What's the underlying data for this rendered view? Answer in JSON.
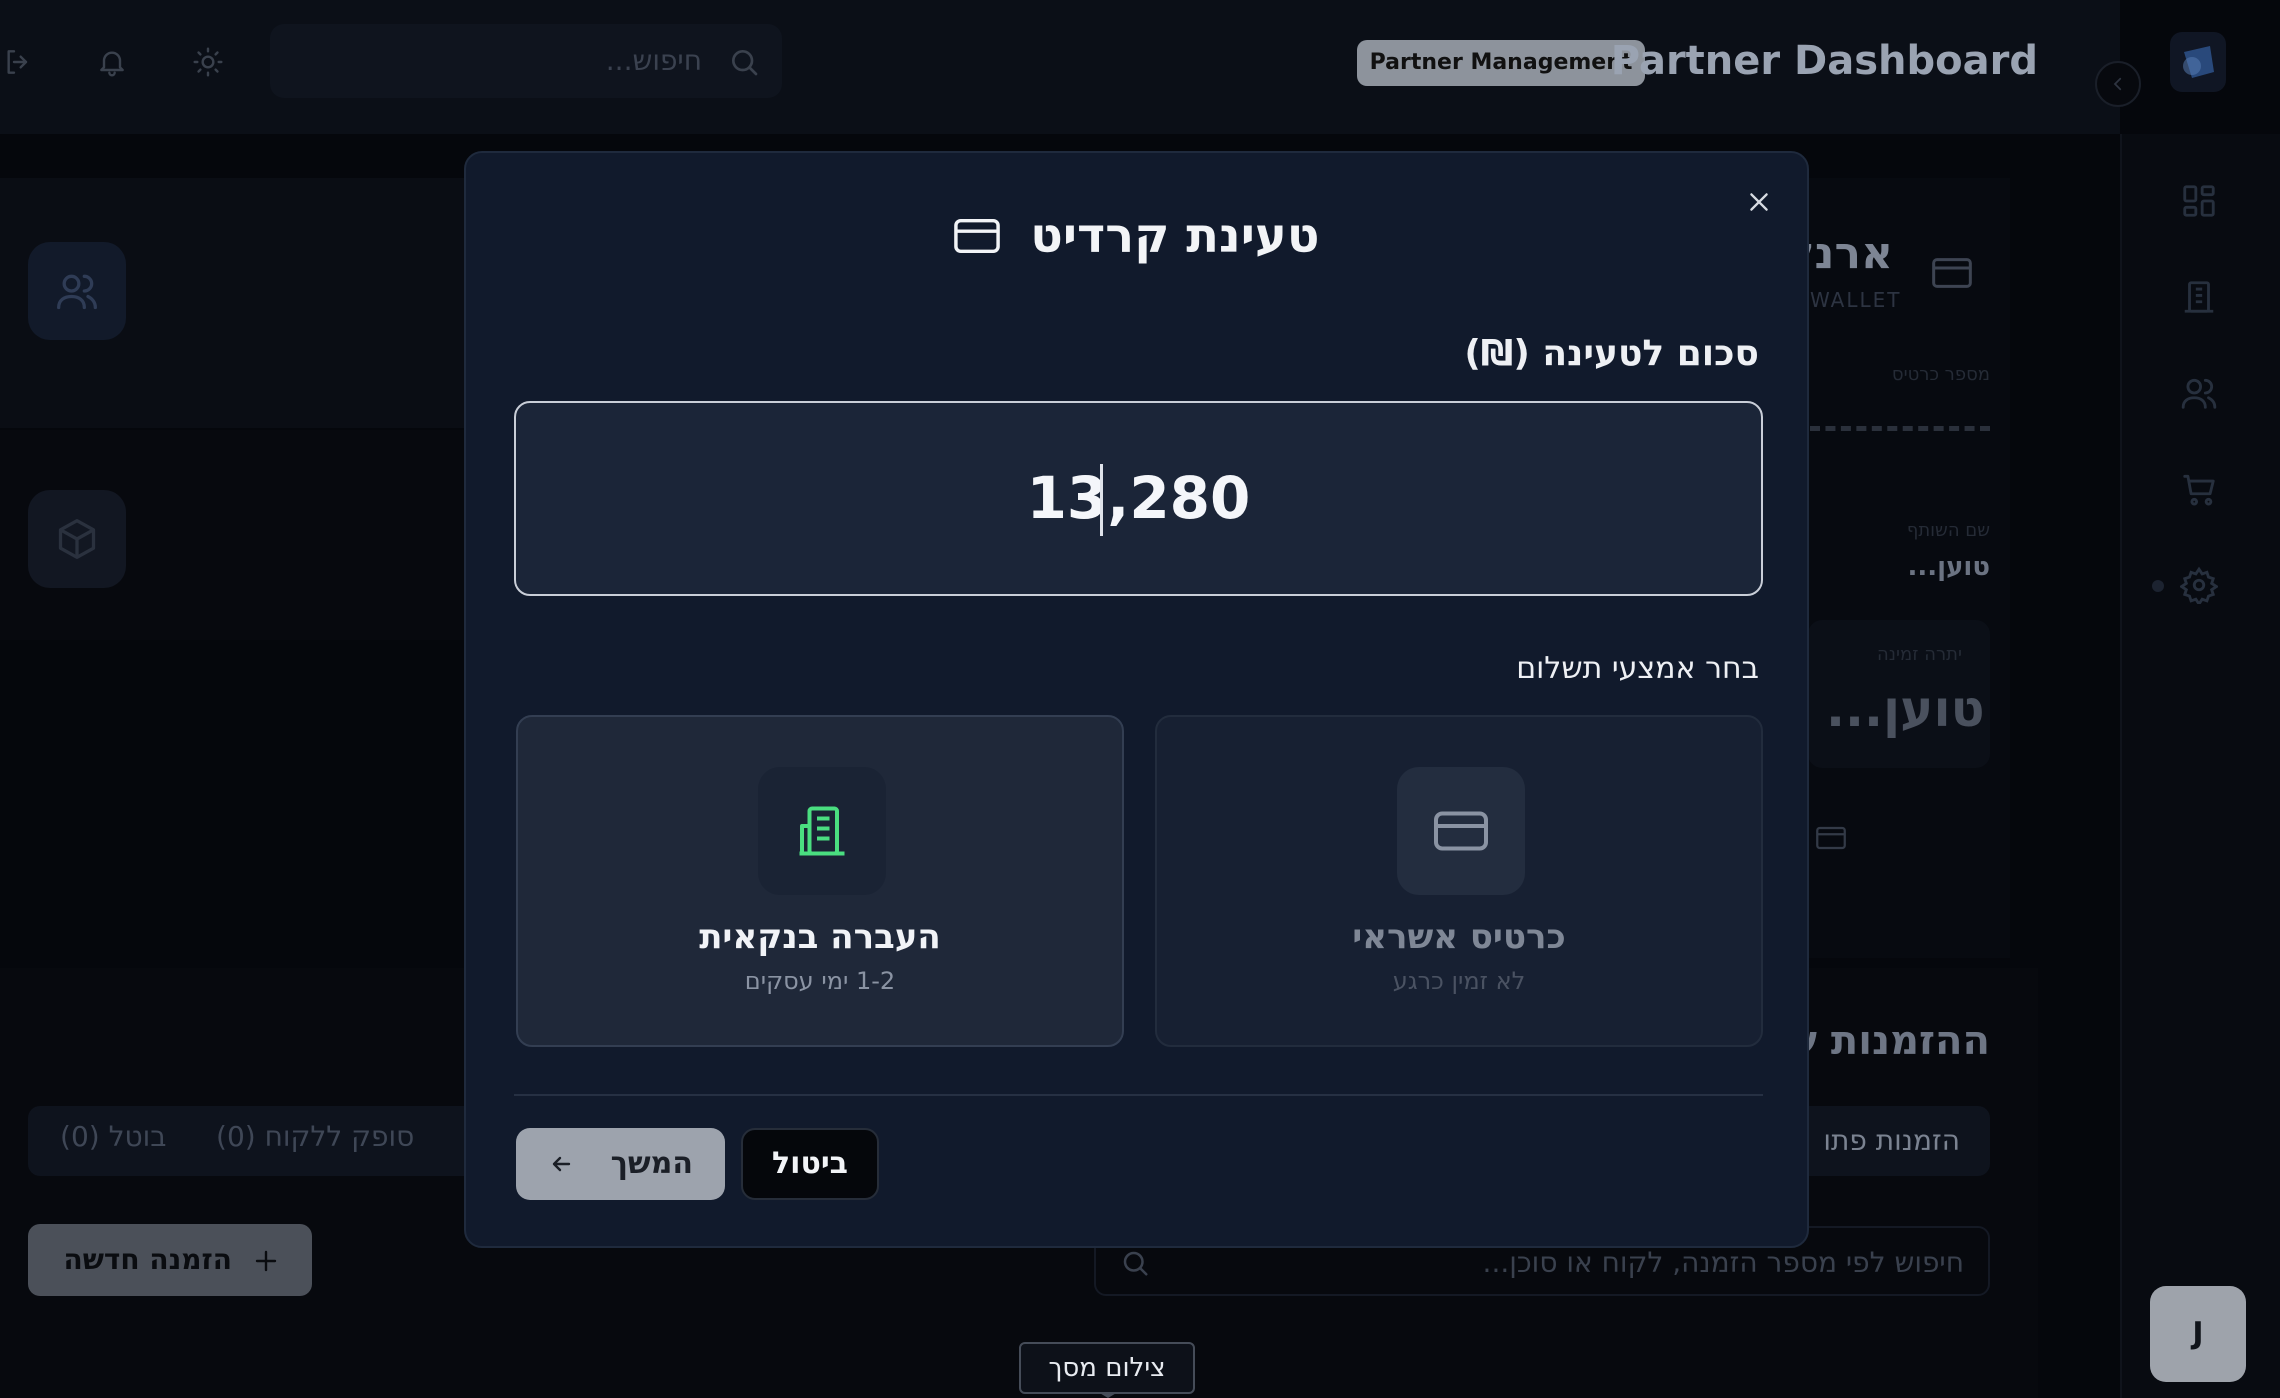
{
  "header": {
    "title": "Partner Dashboard",
    "badge": "Partner Management",
    "search_placeholder": "חיפוש..."
  },
  "left": {
    "tabs": [
      {
        "label": "בוטל (0)"
      },
      {
        "label": "סופק ללקוח (0)"
      }
    ],
    "new_order_label": "הזמנה חדשה"
  },
  "wallet": {
    "title": "ארנק",
    "subtitle": "WALLET",
    "card_number_label": "מספר כרטיס",
    "partner_name_label": "שם השותף",
    "partner_name_value": "טוען...",
    "balance_label": "יתרה זמינה",
    "balance_value": "טוען..."
  },
  "orders": {
    "title": "ההזמנות ש",
    "open_tab": "הזמנות פתו",
    "search_placeholder": "חיפוש לפי מספר הזמנה, לקוח או סוכן..."
  },
  "modal": {
    "title": "טעינת קרדיט",
    "amount_label": "סכום לטעינה (₪)",
    "amount_value": "13,280",
    "method_label": "בחר אמצעי תשלום",
    "methods": [
      {
        "name": "כרטיס אשראי",
        "sub": "לא זמין כרגע",
        "selected": false
      },
      {
        "name": "העברה בנקאית",
        "sub": "1-2 ימי עסקים",
        "selected": true
      }
    ],
    "cancel_label": "ביטול",
    "next_label": "המשך"
  },
  "fab_label": "J",
  "tooltip": "צילום מסך",
  "colors": {
    "accent_green": "#4ade80",
    "modal_bg": "#111a2c",
    "page_bg": "#05070c"
  }
}
